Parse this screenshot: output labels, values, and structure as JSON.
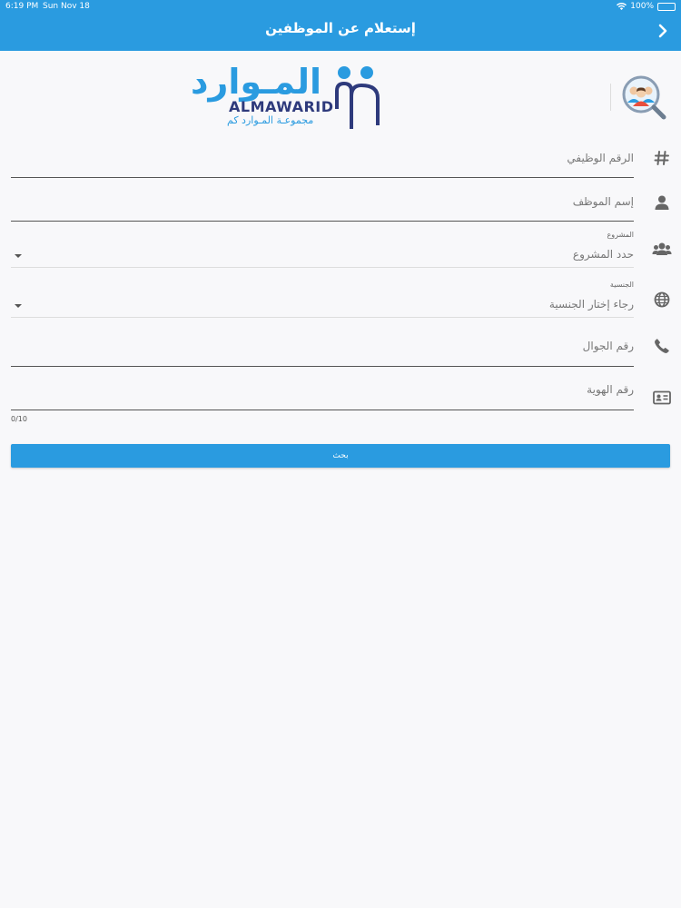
{
  "status_bar": {
    "time": "6:19 PM",
    "date": "Sun Nov 18",
    "battery": "100%"
  },
  "header": {
    "title": "إستعلام عن الموظفين",
    "back_icon": "chevron-right-icon"
  },
  "logo": {
    "arabic": "المـوارد",
    "english": "ALMAWARID",
    "subtitle": "مجموعـة المـوارد كم"
  },
  "form": {
    "employee_number": {
      "placeholder": "الرقم الوظيفي",
      "icon": "hash-icon"
    },
    "employee_name": {
      "placeholder": "إسم الموظف",
      "icon": "person-icon"
    },
    "project": {
      "label": "المشروع",
      "placeholder": "حدد المشروع",
      "icon": "group-icon"
    },
    "nationality": {
      "label": "الجنسية",
      "placeholder": "رجاء إختار الجنسية",
      "icon": "globe-icon"
    },
    "mobile": {
      "placeholder": "رقم الجوال",
      "icon": "phone-icon"
    },
    "id_number": {
      "placeholder": "رقم الهوية",
      "icon": "id-card-icon",
      "counter": "0/10"
    }
  },
  "search_button": {
    "label": "بحث"
  },
  "colors": {
    "primary": "#2a9be0",
    "logo_dark": "#2e3a7c"
  }
}
